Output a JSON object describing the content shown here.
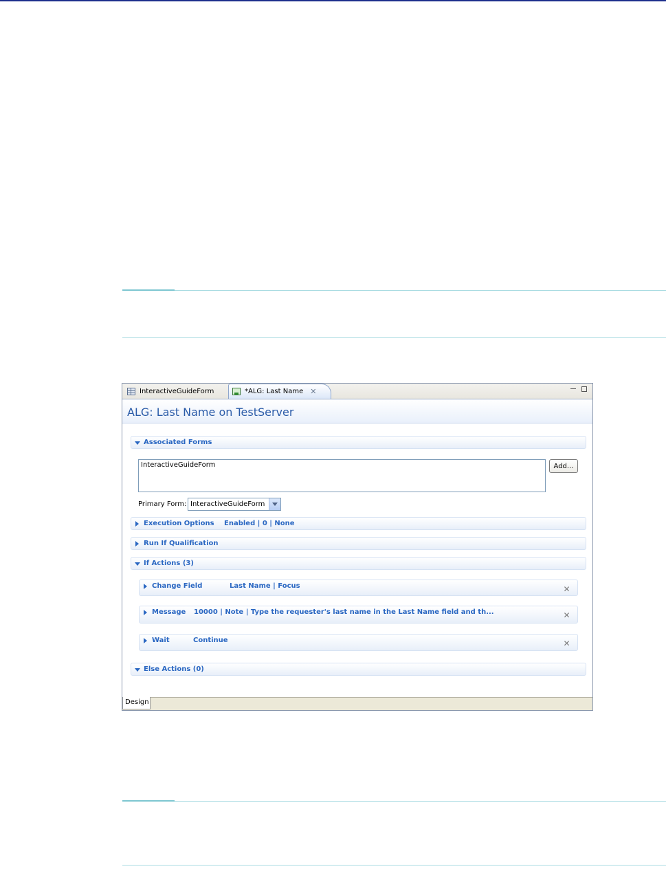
{
  "editor": {
    "tabs": [
      {
        "label": "InteractiveGuideForm"
      },
      {
        "label": "*ALG: Last Name"
      }
    ],
    "title": "ALG: Last Name on TestServer",
    "associated_forms": {
      "label": "Associated Forms",
      "items": [
        "InteractiveGuideForm"
      ],
      "add_button": "Add...",
      "primary_form_label": "Primary Form:",
      "primary_form_value": "InteractiveGuideForm"
    },
    "execution_options": {
      "label": "Execution Options",
      "summary": "Enabled | 0 |  None"
    },
    "run_if": {
      "label": "Run If Qualification"
    },
    "if_actions": {
      "label": "If Actions (3)",
      "actions": [
        {
          "type": "Change Field",
          "summary": "Last Name | Focus"
        },
        {
          "type": "Message",
          "summary": "10000 | Note | Type the requester's last name in the Last Name field and th..."
        },
        {
          "type": "Wait",
          "summary": "Continue"
        }
      ]
    },
    "else_actions": {
      "label": "Else Actions (0)"
    },
    "bottom_tab": "Design"
  }
}
